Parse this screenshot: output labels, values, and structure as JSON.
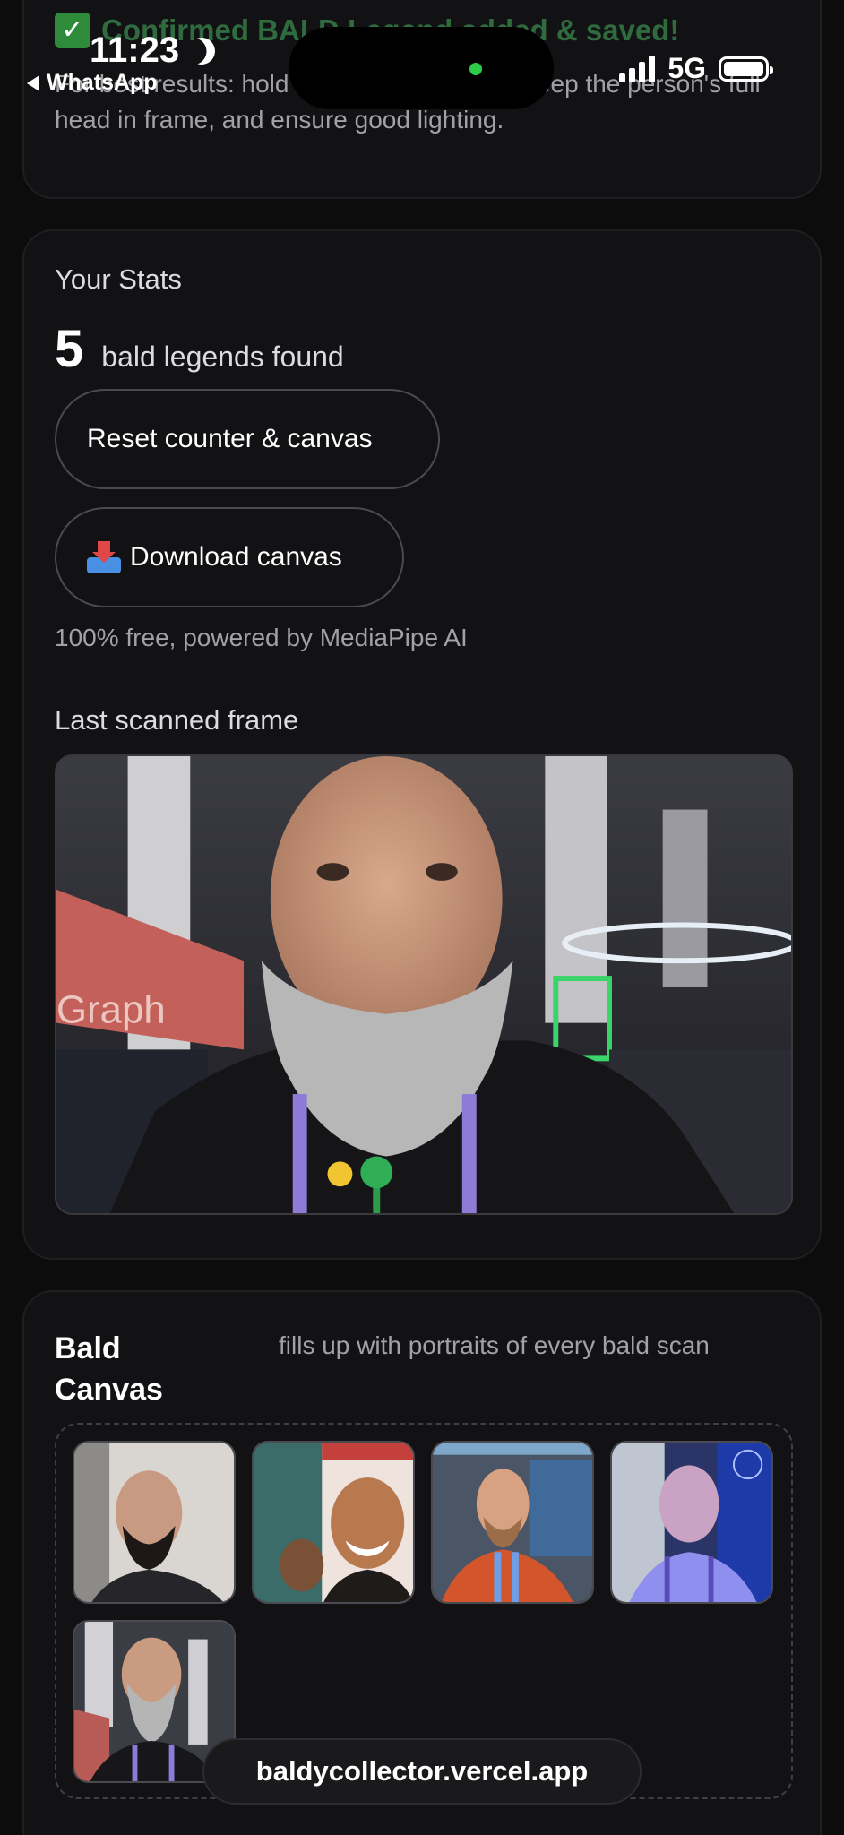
{
  "status_bar": {
    "time": "11:23",
    "back_app": "WhatsApp",
    "network": "5G"
  },
  "confirm_card": {
    "confirm_text": "Confirmed BALD Legend added & saved!",
    "tip_text": "For best results: hold the phone vertically, keep the person's full head in frame, and ensure good lighting."
  },
  "stats": {
    "title": "Your Stats",
    "count": "5",
    "count_label": "bald legends found",
    "reset_label": "Reset counter & canvas",
    "download_label": "Download canvas",
    "free_note": "100% free, powered by MediaPipe AI",
    "frame_label": "Last scanned frame"
  },
  "canvas": {
    "title": "Bald Canvas",
    "subtitle": "fills up with portraits of every bald scan",
    "portraits": 5
  },
  "url_bar": {
    "url": "baldycollector.vercel.app"
  },
  "colors": {
    "background": "#0c0c0d",
    "card": "#121214",
    "confirm_green": "#2f6b3e",
    "lanyard": "#8e7bd8"
  },
  "icons": [
    "moon-icon",
    "back-arrow-icon",
    "signal-icon",
    "battery-icon",
    "check-icon",
    "inbox-tray-icon"
  ]
}
